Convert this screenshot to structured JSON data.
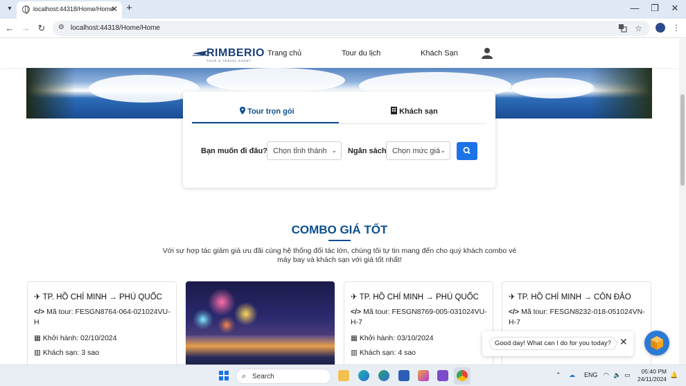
{
  "browser": {
    "tab_title": "localhost:44318/Home/Home",
    "tab_close": "✕",
    "new_tab": "+",
    "url": "localhost:44318/Home/Home",
    "window_controls": [
      "—",
      "❐",
      "✕"
    ]
  },
  "header": {
    "logo_text": "RIMBERIO",
    "logo_tagline": "TOUR & TRAVEL AGENT",
    "nav": [
      "Trang chủ",
      "Tour du lịch",
      "Khách Sạn"
    ],
    "user_icon": "user-icon"
  },
  "search": {
    "tabs": [
      {
        "label": "Tour trọn gói",
        "icon": "map-pin-icon",
        "active": true
      },
      {
        "label": "Khách sạn",
        "icon": "building-icon",
        "active": false
      }
    ],
    "destination_label": "Bạn muốn đi đâu?",
    "destination_value": "Chọn tỉnh thành",
    "budget_label": "Ngân sách",
    "budget_value": "Chọn mức giá",
    "button_icon": "search-icon",
    "accent_color": "#1b73e8"
  },
  "combo": {
    "title": "COMBO GIÁ TỐT",
    "description": "Với sự hợp tác giảm giá ưu đãi cùng hệ thống đối tác lớn, chúng tôi tự tin mang đến cho quý khách combo vé máy bay và khách sạn với giá tốt nhất!",
    "title_color": "#0b4f8e",
    "cards": [
      {
        "route": "TP. HỒ CHÍ MINH → PHÚ QUỐC",
        "code_label": "Mã tour:",
        "code": "FESGN8764-064-021024VU-H",
        "depart_label": "Khởi hành:",
        "depart": "02/10/2024",
        "hotel_label": "Khách sạn:",
        "hotel": "3 sao"
      },
      {
        "route": "TP. HỒ CHÍ MINH → PHÚ QUỐC",
        "code_label": "Mã tour:",
        "code": "FESGN8769-005-031024VU-H-7",
        "depart_label": "Khởi hành:",
        "depart": "03/10/2024",
        "hotel_label": "Khách sạn:",
        "hotel": "4 sao"
      },
      {
        "route": "TP. HỒ CHÍ MINH → CÔN ĐẢO",
        "code_label": "Mã tour:",
        "code": "FESGN8232-018-051024VN-H-7"
      }
    ]
  },
  "chat": {
    "greeting": "Good day! What can I do for you today?",
    "close": "✕"
  },
  "taskbar": {
    "search_label": "Search",
    "language": "ENG",
    "time": "05:40 PM",
    "date": "24/11/2024"
  }
}
